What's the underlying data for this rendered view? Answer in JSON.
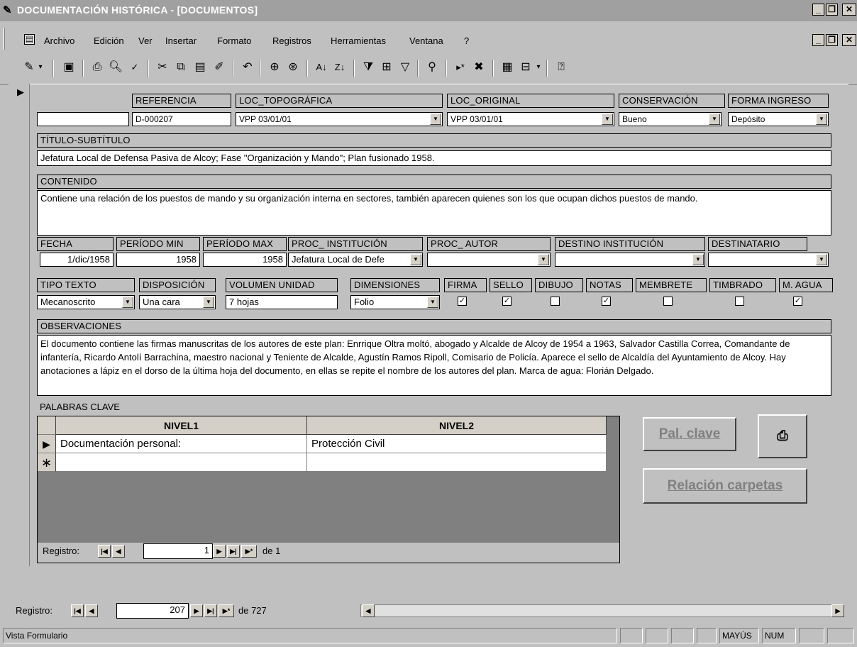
{
  "window": {
    "title": "DOCUMENTACIÓN HISTÓRICA - [DOCUMENTOS]"
  },
  "menu": [
    "Archivo",
    "Edición",
    "Ver",
    "Insertar",
    "Formato",
    "Registros",
    "Herramientas",
    "Ventana",
    "?"
  ],
  "labels": {
    "referencia": "REFERENCIA",
    "loc_topografica": "LOC_TOPOGRÁFICA",
    "loc_original": "LOC_ORIGINAL",
    "conservacion": "CONSERVACIÓN",
    "forma_ingreso": "FORMA INGRESO",
    "titulo": "TÍTULO-SUBTÍTULO",
    "contenido": "CONTENIDO",
    "fecha": "FECHA",
    "periodo_min": "PERÍODO MIN",
    "periodo_max": "PERÍODO MAX",
    "proc_institucion": "PROC_ INSTITUCIÓN",
    "proc_autor": "PROC_ AUTOR",
    "destino_institucion": "DESTINO  INSTITUCIÓN",
    "destinatario": "DESTINATARIO",
    "tipo_texto": "TIPO TEXTO",
    "disposicion": "DISPOSICIÓN",
    "volumen": "VOLUMEN UNIDAD",
    "dimensiones": "DIMENSIONES",
    "firma": "FIRMA",
    "sello": "SELLO",
    "dibujo": "DIBUJO",
    "notas": "NOTAS",
    "membrete": "MEMBRETE",
    "timbrado": "TIMBRADO",
    "m_agua": "M. AGUA",
    "observaciones": "OBSERVACIONES",
    "palabras_clave": "PALABRAS CLAVE"
  },
  "values": {
    "referencia": "D-000207",
    "loc_topografica": "VPP 03/01/01",
    "loc_original": "VPP 03/01/01",
    "conservacion": "Bueno",
    "forma_ingreso": "Depósito",
    "titulo": "Jefatura Local de Defensa Pasiva de Alcoy; Fase \"Organización y Mando\"; Plan fusionado 1958.",
    "contenido": "Contiene una relación de los puestos de mando y su organización interna en sectores, también aparecen quienes son los que ocupan dichos puestos de mando.",
    "fecha": "1/dic/1958",
    "periodo_min": "1958",
    "periodo_max": "1958",
    "proc_institucion": "Jefatura Local de Defe",
    "tipo_texto": "Mecanoscrito",
    "disposicion": "Una cara",
    "volumen": "7 hojas",
    "dimensiones": "Folio",
    "observaciones": "El documento contiene las firmas manuscritas de los autores de este plan: Enrrique Oltra moltó, abogado y Alcalde de Alcoy de 1954 a 1963, Salvador Castilla Correa, Comandante de infantería, Ricardo Antolí Barrachina, maestro nacional y Teniente de Alcalde, Agustín Ramos Ripoll, Comisario de Policía. Aparece el sello de Alcaldía del Ayuntamiento de Alcoy. Hay anotaciones a lápiz en el dorso de la última hoja del documento, en ellas se repite el nombre de los autores del plan. Marca de agua: Florián Delgado."
  },
  "checks": {
    "firma": true,
    "sello": true,
    "dibujo": false,
    "notas": true,
    "membrete": false,
    "timbrado": false,
    "m_agua": true
  },
  "grid": {
    "col1": "NIVEL1",
    "col2": "NIVEL2",
    "row1_c1": "Documentación personal:",
    "row1_c2": "Protección Civil"
  },
  "buttons": {
    "pal_clave": "Pal. clave",
    "relacion": "Relación carpetas"
  },
  "subnav": {
    "label": "Registro:",
    "current": "1",
    "of_text": "de 1"
  },
  "mainnav": {
    "label": "Registro:",
    "current": "207",
    "of_text": "de 727"
  },
  "status": {
    "text": "Vista Formulario",
    "mayus": "MAYÚS",
    "num": "NUM"
  }
}
